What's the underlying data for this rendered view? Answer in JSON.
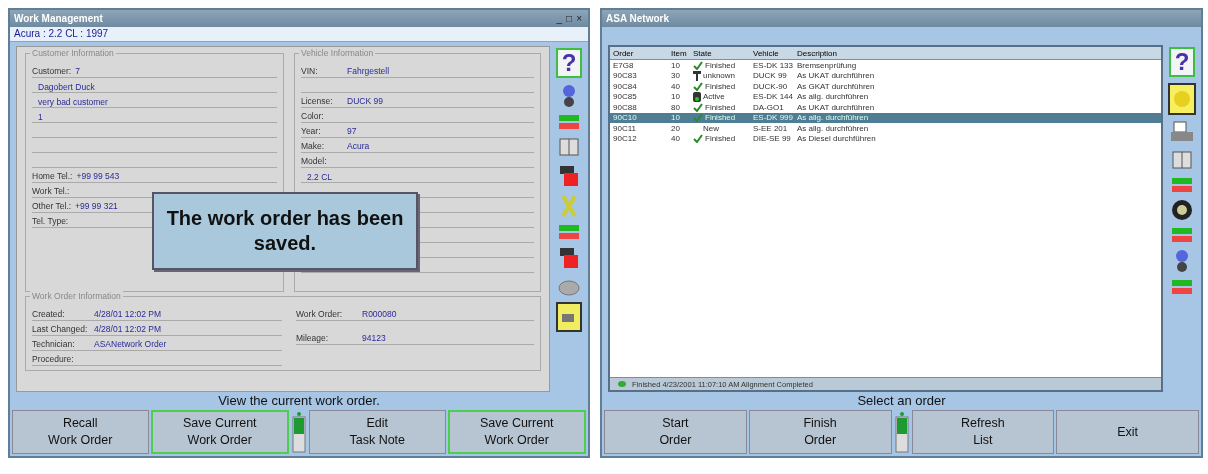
{
  "work_management": {
    "title": "Work Management",
    "help_button": "?",
    "window_controls": [
      "_",
      "□",
      "×"
    ],
    "vehicle_line": "Acura : 2.2 CL : 1997",
    "customer_info": {
      "legend": "Customer Information",
      "customer": {
        "label": "Customer:",
        "value": "7"
      },
      "lines": [
        "Dagobert Duck",
        "very bad customer",
        "1"
      ],
      "phones": [
        {
          "label": "Home Tel.:",
          "value": "+99 99 543"
        },
        {
          "label": "Work Tel.:"
        },
        {
          "label": "Other Tel.:",
          "value": "+99 99 321"
        },
        {
          "label": "Tel. Type:"
        }
      ]
    },
    "vehicle_info": {
      "legend": "Vehicle Information",
      "fields": [
        {
          "label": "VIN:",
          "value": "Fahrgestell"
        },
        {
          "label": "License:",
          "value": "DUCK 99"
        },
        {
          "label": "Color:"
        },
        {
          "label": "Year:",
          "value": "97"
        },
        {
          "label": "Make:",
          "value": "Acura"
        },
        {
          "label": "Model:"
        }
      ],
      "model_value": "2.2 CL"
    },
    "work_order_info": {
      "legend": "Work Order Information",
      "left": [
        {
          "label": "Created:",
          "value": "4/28/01 12:02 PM"
        },
        {
          "label": "Last Changed:",
          "value": "4/28/01 12:02 PM"
        },
        {
          "label": "Technician:",
          "value": "ASANetwork Order"
        },
        {
          "label": "Procedure:"
        }
      ],
      "right": [
        {
          "label": "Work Order:",
          "value": "R000080"
        },
        {
          "label": "Mileage:",
          "value": "94123"
        }
      ]
    },
    "message": "The work order has been saved.",
    "status": "View the current work order.",
    "buttons": [
      {
        "kind": "button",
        "label": "Recall\nWork Order",
        "highlighted": false
      },
      {
        "kind": "button",
        "label": "Save Current\nWork Order",
        "highlighted": true
      },
      {
        "kind": "indicator"
      },
      {
        "kind": "button",
        "label": "Edit\nTask Note",
        "highlighted": false
      },
      {
        "kind": "button",
        "label": "Save Current\nWork Order",
        "highlighted": true
      }
    ]
  },
  "asa_network": {
    "title": "ASA Network",
    "help_button": "?",
    "table": {
      "columns": [
        "Order",
        "Item",
        "State",
        "Vehicle",
        "Description"
      ],
      "rows": [
        {
          "order": "E7G8",
          "item": "10",
          "kind": "finished",
          "state": "Finished",
          "vehicle": "ES-DK 133",
          "description": "Bremsenprüfung",
          "selected": false
        },
        {
          "order": "90C83",
          "item": "30",
          "kind": "unknown",
          "state": "unknown",
          "vehicle": "DUCK 99",
          "description": "As UKAT durchführen",
          "selected": false
        },
        {
          "order": "90C84",
          "item": "40",
          "kind": "finished",
          "state": "Finished",
          "vehicle": "DUCK-90",
          "description": "As GKAT durchführen",
          "selected": false
        },
        {
          "order": "90C85",
          "item": "10",
          "kind": "active",
          "state": "Active",
          "vehicle": "ES-DK 144",
          "description": "As allg. durchführen",
          "selected": false
        },
        {
          "order": "90C88",
          "item": "80",
          "kind": "finished",
          "state": "Finished",
          "vehicle": "DA-GO1",
          "description": "As UKAT durchführen",
          "selected": false
        },
        {
          "order": "90C10",
          "item": "10",
          "kind": "finished",
          "state": "Finished",
          "vehicle": "ES-DK 999",
          "description": "As allg. durchführen",
          "selected": true
        },
        {
          "order": "90C11",
          "item": "20",
          "kind": "new",
          "state": "New",
          "vehicle": "S-EE 201",
          "description": "As allg. durchführen",
          "selected": false
        },
        {
          "order": "90C12",
          "item": "40",
          "kind": "finished",
          "state": "Finished",
          "vehicle": "DIE-SE 99",
          "description": "As Diesel durchführen",
          "selected": false
        }
      ]
    },
    "status_bar": "Finished 4/23/2001 11:07:10 AM Alignment Completed",
    "status": "Select an order",
    "buttons": [
      {
        "kind": "button",
        "label": "Start\nOrder",
        "highlighted": false
      },
      {
        "kind": "button",
        "label": "Finish\nOrder",
        "highlighted": false
      },
      {
        "kind": "indicator"
      },
      {
        "kind": "button",
        "label": "Refresh\nList",
        "highlighted": false
      },
      {
        "kind": "button",
        "label": "Exit",
        "highlighted": false
      }
    ]
  }
}
